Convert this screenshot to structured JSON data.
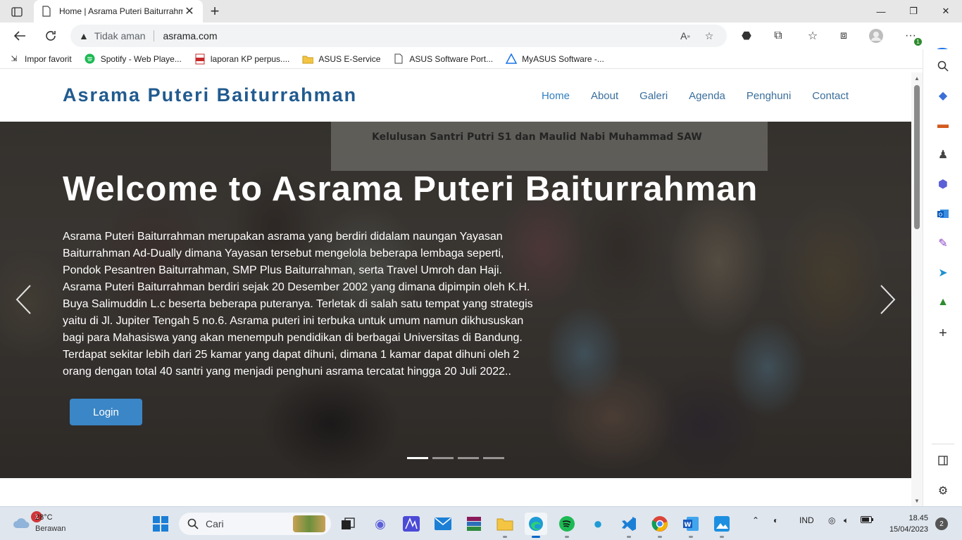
{
  "browser": {
    "tab_title": "Home | Asrama Puteri Baiturrahm",
    "address_security": "Tidak aman",
    "address_url": "asrama.com",
    "bookmarks": [
      {
        "label": "Impor favorit"
      },
      {
        "label": "Spotify - Web Playe..."
      },
      {
        "label": "laporan KP perpus...."
      },
      {
        "label": "ASUS E-Service"
      },
      {
        "label": "ASUS Software Port..."
      },
      {
        "label": "MyASUS Software -..."
      }
    ],
    "extension_badge": "1"
  },
  "site": {
    "brand": "Asrama Puteri Baiturrahman",
    "nav": [
      "Home",
      "About",
      "Galeri",
      "Agenda",
      "Penghuni",
      "Contact"
    ],
    "active_nav": "Home",
    "hero": {
      "banner_text": "Kelulusan Santri Putri S1 dan Maulid Nabi Muhammad SAW",
      "title": "Welcome to Asrama Puteri Baiturrahman",
      "lines": [
        "Asrama Puteri Baiturrahman merupakan asrama yang berdiri didalam naungan Yayasan",
        "Baiturrahman Ad-Dually dimana Yayasan tersebut mengelola beberapa lembaga seperti,",
        "Pondok Pesantren Baiturrahman, SMP Plus Baiturrahman, serta Travel Umroh dan Haji.",
        "Asrama Puteri Baiturrahman berdiri sejak 20 Desember 2002 yang dimana dipimpin oleh K.H.",
        "Buya Salimuddin L.c beserta beberapa puteranya. Terletak di salah satu tempat yang strategis",
        "yaitu di Jl. Jupiter Tengah 5 no.6. Asrama puteri ini terbuka untuk umum namun dikhususkan",
        "bagi para Mahasiswa yang akan menempuh pendidikan di berbagai Universitas di Bandung.",
        "Terdapat sekitar lebih dari 25 kamar yang dapat dihuni, dimana 1 kamar dapat dihuni oleh 2",
        "orang dengan total 40 santri yang menjadi penghuni asrama tercatat hingga 20 Juli 2022.."
      ],
      "button": "Login",
      "slide_count": 4,
      "active_slide": 1
    }
  },
  "taskbar": {
    "weather_badge": "1",
    "weather_temp": "28°C",
    "weather_desc": "Berawan",
    "search_placeholder": "Cari",
    "lang": "IND",
    "time": "18.45",
    "date": "15/04/2023",
    "notification_count": "2"
  },
  "colors": {
    "brand": "#215b8f",
    "nav_link": "#3a6e9c",
    "button": "#3b86c6",
    "edge_accent": "#1a73e8"
  }
}
